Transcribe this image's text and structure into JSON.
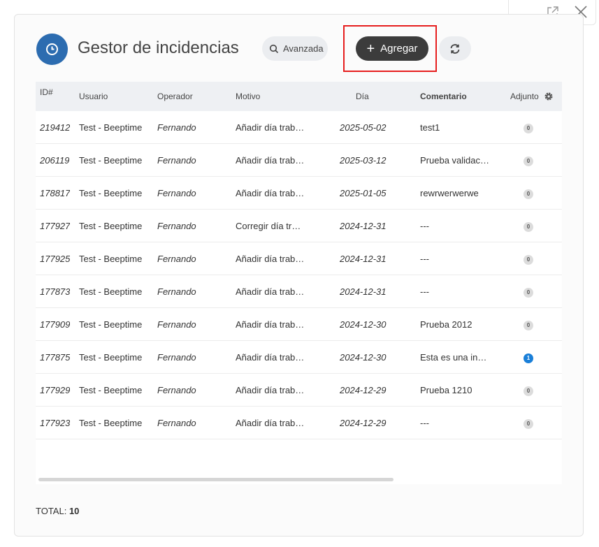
{
  "window": {
    "minimize_icon": "minimize-icon",
    "external_icon": "external-window-icon",
    "close_icon": "close-icon"
  },
  "header": {
    "title": "Gestor de incidencias",
    "advanced_label": "Avanzada",
    "add_label": "Agregar",
    "brand_color": "#2c6cb0"
  },
  "table": {
    "columns": [
      "ID#",
      "Usuario",
      "Operador",
      "Motivo",
      "Día",
      "Comentario",
      "Adjunto"
    ],
    "rows": [
      {
        "id": "219412",
        "usuario": "Test - Beeptime",
        "operador": "Fernando",
        "motivo": "Añadir día trab…",
        "dia": "2025-05-02",
        "comentario": "test1",
        "adjunto": "0"
      },
      {
        "id": "206119",
        "usuario": "Test - Beeptime",
        "operador": "Fernando",
        "motivo": "Añadir día trab…",
        "dia": "2025-03-12",
        "comentario": "Prueba validac…",
        "adjunto": "0"
      },
      {
        "id": "178817",
        "usuario": "Test - Beeptime",
        "operador": "Fernando",
        "motivo": "Añadir día trab…",
        "dia": "2025-01-05",
        "comentario": "rewrwerwerwe",
        "adjunto": "0"
      },
      {
        "id": "177927",
        "usuario": "Test - Beeptime",
        "operador": "Fernando",
        "motivo": "Corregir día tr…",
        "dia": "2024-12-31",
        "comentario": "---",
        "adjunto": "0"
      },
      {
        "id": "177925",
        "usuario": "Test - Beeptime",
        "operador": "Fernando",
        "motivo": "Añadir día trab…",
        "dia": "2024-12-31",
        "comentario": "---",
        "adjunto": "0"
      },
      {
        "id": "177873",
        "usuario": "Test - Beeptime",
        "operador": "Fernando",
        "motivo": "Añadir día trab…",
        "dia": "2024-12-31",
        "comentario": "---",
        "adjunto": "0"
      },
      {
        "id": "177909",
        "usuario": "Test - Beeptime",
        "operador": "Fernando",
        "motivo": "Añadir día trab…",
        "dia": "2024-12-30",
        "comentario": "Prueba 2012",
        "adjunto": "0"
      },
      {
        "id": "177875",
        "usuario": "Test - Beeptime",
        "operador": "Fernando",
        "motivo": "Añadir día trab…",
        "dia": "2024-12-30",
        "comentario": "Esta es una in…",
        "adjunto": "1"
      },
      {
        "id": "177929",
        "usuario": "Test - Beeptime",
        "operador": "Fernando",
        "motivo": "Añadir día trab…",
        "dia": "2024-12-29",
        "comentario": "Prueba 1210",
        "adjunto": "0"
      },
      {
        "id": "177923",
        "usuario": "Test - Beeptime",
        "operador": "Fernando",
        "motivo": "Añadir día trab…",
        "dia": "2024-12-29",
        "comentario": "---",
        "adjunto": "0"
      }
    ]
  },
  "footer": {
    "total_label": "TOTAL:",
    "total_value": "10"
  }
}
